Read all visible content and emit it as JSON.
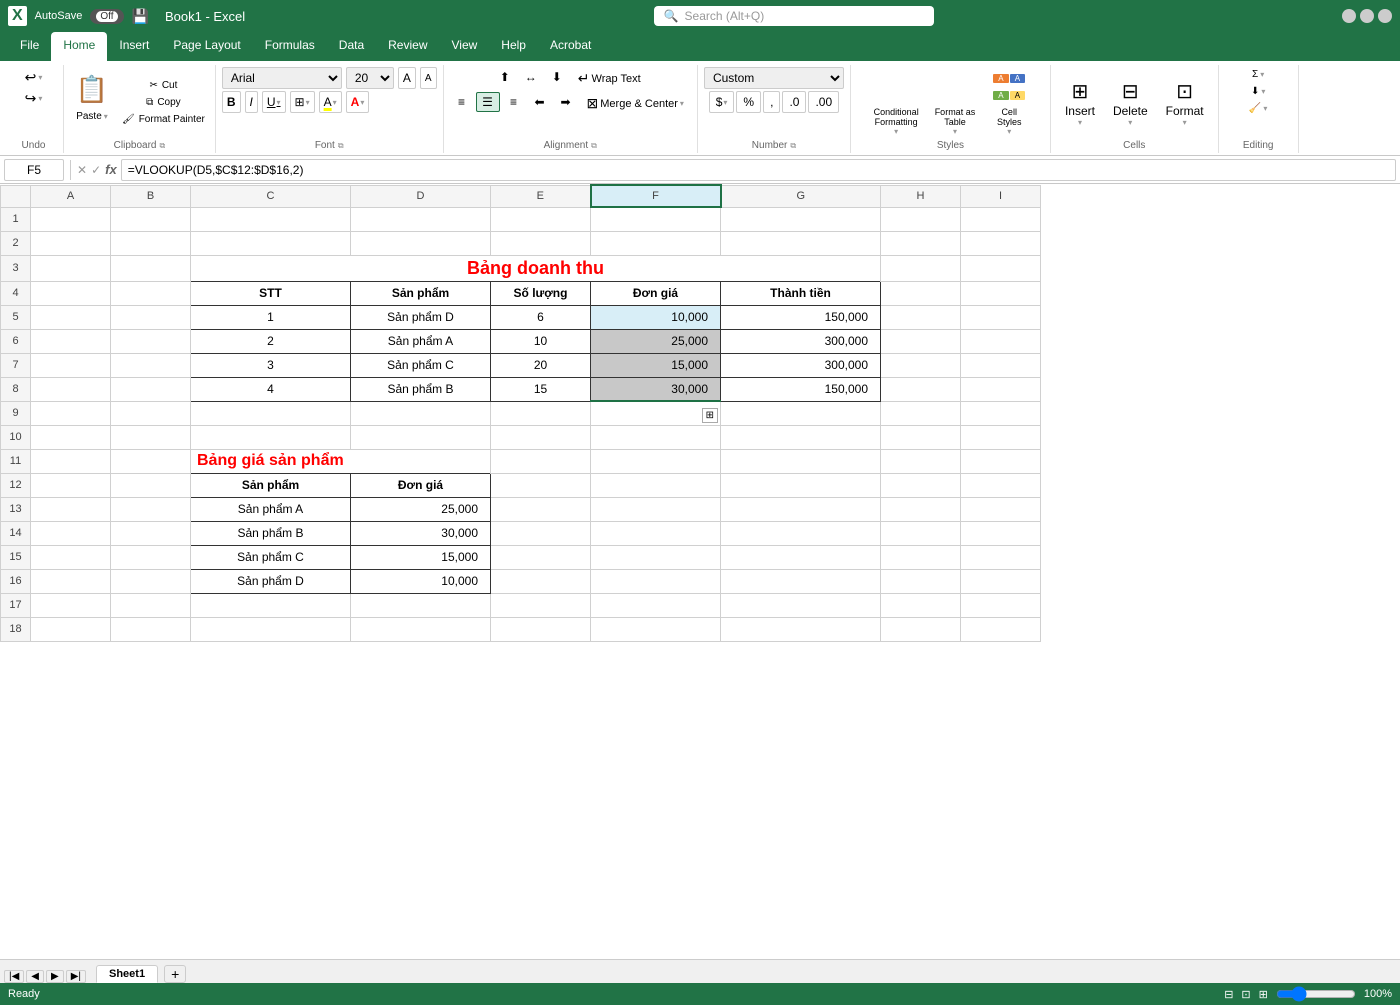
{
  "titleBar": {
    "appIcon": "X",
    "autoSaveLabel": "AutoSave",
    "toggleState": "Off",
    "saveIcon": "💾",
    "fileName": "Book1  -  Excel",
    "searchPlaceholder": "Search (Alt+Q)"
  },
  "ribbonTabs": [
    {
      "id": "file",
      "label": "File"
    },
    {
      "id": "home",
      "label": "Home",
      "active": true
    },
    {
      "id": "insert",
      "label": "Insert"
    },
    {
      "id": "pageLayout",
      "label": "Page Layout"
    },
    {
      "id": "formulas",
      "label": "Formulas"
    },
    {
      "id": "data",
      "label": "Data"
    },
    {
      "id": "review",
      "label": "Review"
    },
    {
      "id": "view",
      "label": "View"
    },
    {
      "id": "help",
      "label": "Help"
    },
    {
      "id": "acrobat",
      "label": "Acrobat"
    }
  ],
  "ribbon": {
    "undoGroup": {
      "label": "Undo",
      "undo": "↩",
      "redo": "↪"
    },
    "clipboardGroup": {
      "label": "Clipboard",
      "paste": "📋",
      "pasteLabel": "Paste",
      "cut": "✂",
      "cutLabel": "Cut",
      "copy": "⧉",
      "copyLabel": "Copy",
      "formatPaint": "🖌",
      "formatPaintLabel": "Format Painter"
    },
    "fontGroup": {
      "label": "Font",
      "fontName": "Arial",
      "fontSize": "20",
      "growLabel": "A",
      "shrinkLabel": "A",
      "bold": "B",
      "italic": "I",
      "underline": "U",
      "border": "⊞",
      "fillColor": "A",
      "fontColor": "A"
    },
    "alignmentGroup": {
      "label": "Alignment",
      "wrapText": "Wrap Text",
      "mergeCenter": "Merge & Center"
    },
    "numberGroup": {
      "label": "Number",
      "format": "Custom",
      "dollar": "$",
      "percent": "%",
      "comma": ",",
      "decimalIncrease": ".0",
      "decimalDecrease": ".00"
    },
    "stylesGroup": {
      "label": "Styles",
      "conditionalFormatting": "Conditional\nFormatting",
      "formatAsTable": "Format as\nTable",
      "cellStyles": "Cell\nStyles"
    },
    "cellsGroup": {
      "label": "Cells",
      "insert": "Insert",
      "delete": "Delete",
      "format": "Format"
    }
  },
  "formulaBar": {
    "cellRef": "F5",
    "formula": "=VLOOKUP(D5,$C$12:$D$16,2)"
  },
  "columns": [
    "",
    "A",
    "B",
    "C",
    "D",
    "E",
    "F",
    "G",
    "H",
    "I"
  ],
  "rows": [
    {
      "row": 1,
      "cells": [
        "",
        "",
        "",
        "",
        "",
        "",
        "",
        "",
        ""
      ]
    },
    {
      "row": 2,
      "cells": [
        "",
        "",
        "",
        "",
        "",
        "",
        "",
        "",
        ""
      ]
    },
    {
      "row": 3,
      "cells": [
        "",
        "",
        "",
        "Bảng doanh thu",
        "",
        "",
        "",
        "",
        ""
      ]
    },
    {
      "row": 4,
      "cells": [
        "",
        "",
        "STT",
        "Sản phẩm",
        "Số lượng",
        "Đơn giá",
        "Thành tiền",
        "",
        ""
      ]
    },
    {
      "row": 5,
      "cells": [
        "",
        "",
        "1",
        "Sản phẩm D",
        "6",
        "10,000",
        "150,000",
        "",
        ""
      ]
    },
    {
      "row": 6,
      "cells": [
        "",
        "",
        "2",
        "Sản phẩm A",
        "10",
        "25,000",
        "300,000",
        "",
        ""
      ]
    },
    {
      "row": 7,
      "cells": [
        "",
        "",
        "3",
        "Sản phẩm C",
        "20",
        "15,000",
        "300,000",
        "",
        ""
      ]
    },
    {
      "row": 8,
      "cells": [
        "",
        "",
        "4",
        "Sản phẩm B",
        "15",
        "30,000",
        "150,000",
        "",
        ""
      ]
    },
    {
      "row": 9,
      "cells": [
        "",
        "",
        "",
        "",
        "",
        "",
        "",
        "",
        ""
      ]
    },
    {
      "row": 10,
      "cells": [
        "",
        "",
        "",
        "",
        "",
        "",
        "",
        "",
        ""
      ]
    },
    {
      "row": 11,
      "cells": [
        "",
        "",
        "Bảng giá sản phẩm",
        "",
        "",
        "",
        "",
        "",
        ""
      ]
    },
    {
      "row": 12,
      "cells": [
        "",
        "",
        "Sản phẩm",
        "Đơn giá",
        "",
        "",
        "",
        "",
        ""
      ]
    },
    {
      "row": 13,
      "cells": [
        "",
        "",
        "Sản phẩm A",
        "25,000",
        "",
        "",
        "",
        "",
        ""
      ]
    },
    {
      "row": 14,
      "cells": [
        "",
        "",
        "Sản phẩm B",
        "30,000",
        "",
        "",
        "",
        "",
        ""
      ]
    },
    {
      "row": 15,
      "cells": [
        "",
        "",
        "Sản phẩm C",
        "15,000",
        "",
        "",
        "",
        "",
        ""
      ]
    },
    {
      "row": 16,
      "cells": [
        "",
        "",
        "Sản phẩm D",
        "10,000",
        "",
        "",
        "",
        "",
        ""
      ]
    },
    {
      "row": 17,
      "cells": [
        "",
        "",
        "",
        "",
        "",
        "",
        "",
        "",
        ""
      ]
    },
    {
      "row": 18,
      "cells": [
        "",
        "",
        "",
        "",
        "",
        "",
        "",
        "",
        ""
      ]
    }
  ],
  "sheetTabs": [
    {
      "id": "sheet1",
      "label": "Sheet1",
      "active": true
    }
  ],
  "statusBar": {
    "mode": "Ready",
    "zoom": "100%"
  }
}
